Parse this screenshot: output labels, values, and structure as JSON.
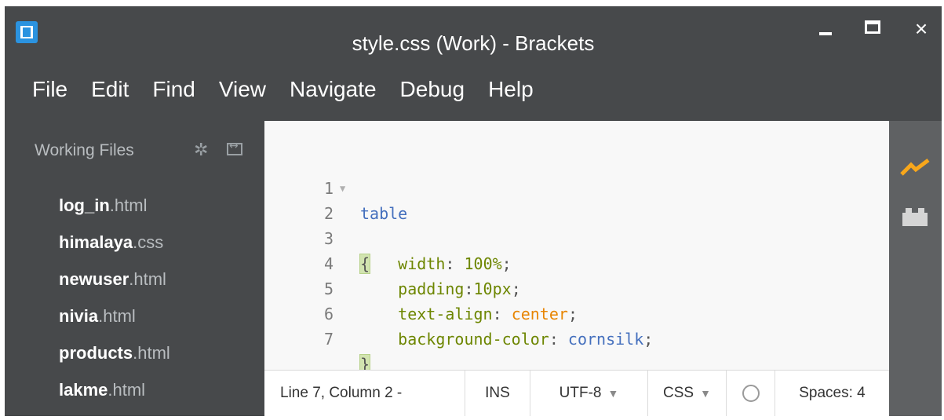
{
  "window": {
    "title": "style.css (Work) - Brackets",
    "close_glyph": "×"
  },
  "menu": [
    "File",
    "Edit",
    "Find",
    "View",
    "Navigate",
    "Debug",
    "Help"
  ],
  "sidebar": {
    "header": "Working Files",
    "files": [
      {
        "name": "log_in",
        "ext": ".html"
      },
      {
        "name": "himalaya",
        "ext": ".css"
      },
      {
        "name": "newuser",
        "ext": ".html"
      },
      {
        "name": "nivia",
        "ext": ".html"
      },
      {
        "name": "products",
        "ext": ".html"
      },
      {
        "name": "lakme",
        "ext": ".html"
      }
    ]
  },
  "editor": {
    "line_numbers": [
      "1",
      "2",
      "3",
      "4",
      "5",
      "6",
      "7"
    ],
    "code": {
      "selector": "table",
      "open_brace": "{",
      "close_brace": "}",
      "decls": [
        {
          "prop": "width",
          "sep": ": ",
          "value": "100%",
          "end": ";"
        },
        {
          "prop": "padding",
          "sep": ":",
          "value": "10px",
          "end": ";"
        },
        {
          "prop": "text-align",
          "sep": ": ",
          "value": "center",
          "end": ";"
        },
        {
          "prop": "background-color",
          "sep": ": ",
          "value": "cornsilk",
          "end": ";"
        }
      ]
    }
  },
  "statusbar": {
    "cursor": "Line 7, Column 2 -",
    "mode": "INS",
    "encoding": "UTF-8",
    "language": "CSS",
    "indent": "Spaces: 4"
  },
  "icons": {
    "app": "brackets-logo-icon",
    "live_preview": "live-preview-icon",
    "extensions": "extension-manager-icon",
    "settings": "gear-icon",
    "split": "split-view-icon"
  },
  "colors": {
    "chrome": "#47494b",
    "toolbar": "#5f6163",
    "accent": "#2b93e0",
    "live_preview": "#f8a71b"
  }
}
